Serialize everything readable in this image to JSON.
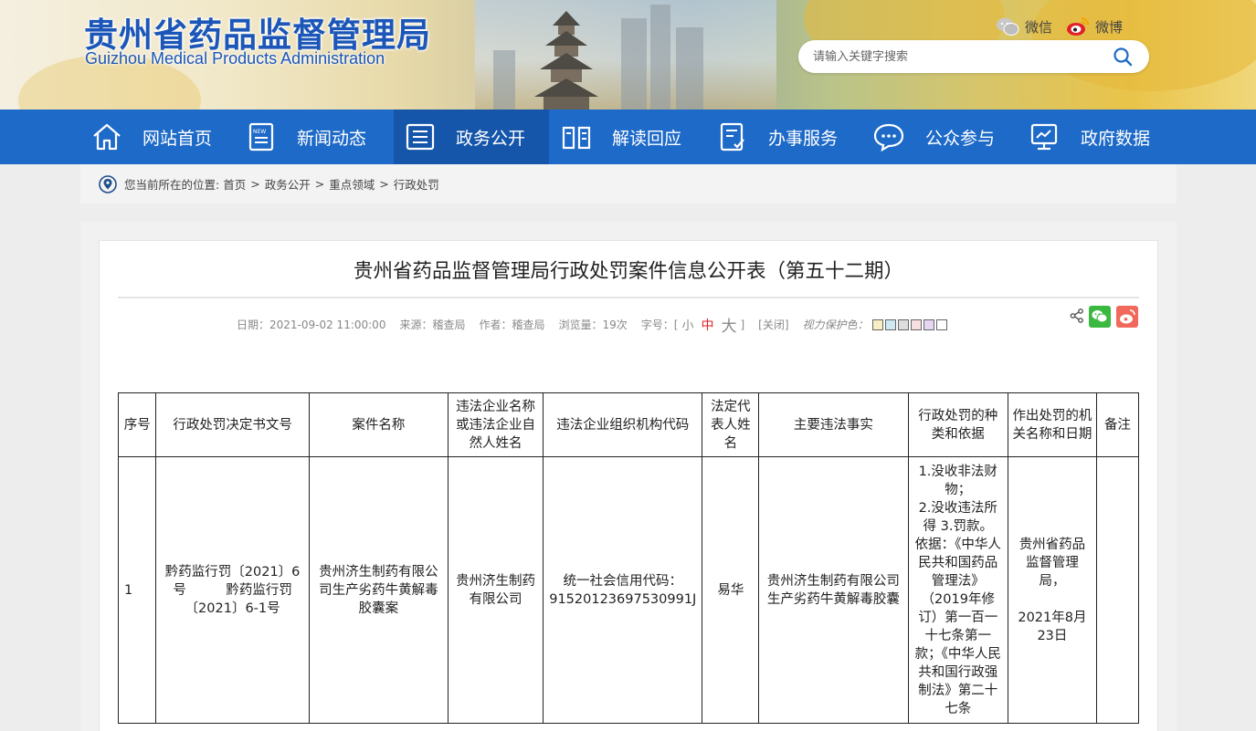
{
  "header": {
    "logo_cn": "贵州省药品监督管理局",
    "logo_en": "Guizhou Medical Products Administration",
    "wechat_label": "微信",
    "weibo_label": "微博",
    "search_placeholder": "请输入关键字搜索"
  },
  "nav": {
    "items": [
      {
        "label": "网站首页",
        "icon": "home-icon"
      },
      {
        "label": "新闻动态",
        "icon": "news-icon"
      },
      {
        "label": "政务公开",
        "icon": "list-icon",
        "active": true
      },
      {
        "label": "解读回应",
        "icon": "book-icon"
      },
      {
        "label": "办事服务",
        "icon": "form-icon"
      },
      {
        "label": "公众参与",
        "icon": "chat-icon"
      },
      {
        "label": "政府数据",
        "icon": "monitor-icon"
      }
    ]
  },
  "breadcrumb": {
    "prefix": "您当前所在的位置:",
    "items": [
      "首页",
      "政务公开",
      "重点领域",
      "行政处罚"
    ]
  },
  "article": {
    "title": "贵州省药品监督管理局行政处罚案件信息公开表（第五十二期）",
    "date": "日期：2021-09-02 11:00:00",
    "source": "来源：稽查局",
    "author": "作者：稽查局",
    "views": "浏览量：19次",
    "font_size_label": "字号：[",
    "font_small": "小",
    "font_medium": "中",
    "font_large": "大",
    "font_close": "]",
    "close_label": "[关闭]",
    "eye_care_label": "视力保护色：",
    "eye_colors": [
      "#f6efc3",
      "#cfe9f3",
      "#dedede",
      "#f6dfe1",
      "#e6d6f2",
      "#ffffff"
    ]
  },
  "table": {
    "headers": [
      "序号",
      "行政处罚决定书文号",
      "案件名称",
      "违法企业名称或违法企业自然人姓名",
      "违法企业组织机构代码",
      "法定代表人姓名",
      "主要违法事实",
      "行政处罚的种类和依据",
      "作出处罚的机关名称和日期",
      "备注"
    ],
    "row": {
      "index": "1",
      "doc_no": "黔药监行罚〔2021〕6号　　　黔药监行罚〔2021〕6-1号",
      "case_name": "贵州济生制药有限公司生产劣药牛黄解毒胶囊案",
      "company": "贵州济生制药有限公司",
      "org_code": "统一社会信用代码：91520123697530991J",
      "legal_rep": "易华",
      "facts": "贵州济生制药有限公司生产劣药牛黄解毒胶囊",
      "penalty_1": "1.没收非法财物；",
      "penalty_2": "2.没收违法所得 3.罚款。",
      "penalty_basis": "依据：《中华人民共和国药品管理法》（2019年修订）第一百一十七条第一款；《中华人民共和国行政强制法》第二十七条",
      "authority": "贵州省药品监督管理局，",
      "authority_date": "2021年8月23日",
      "remark": ""
    }
  }
}
